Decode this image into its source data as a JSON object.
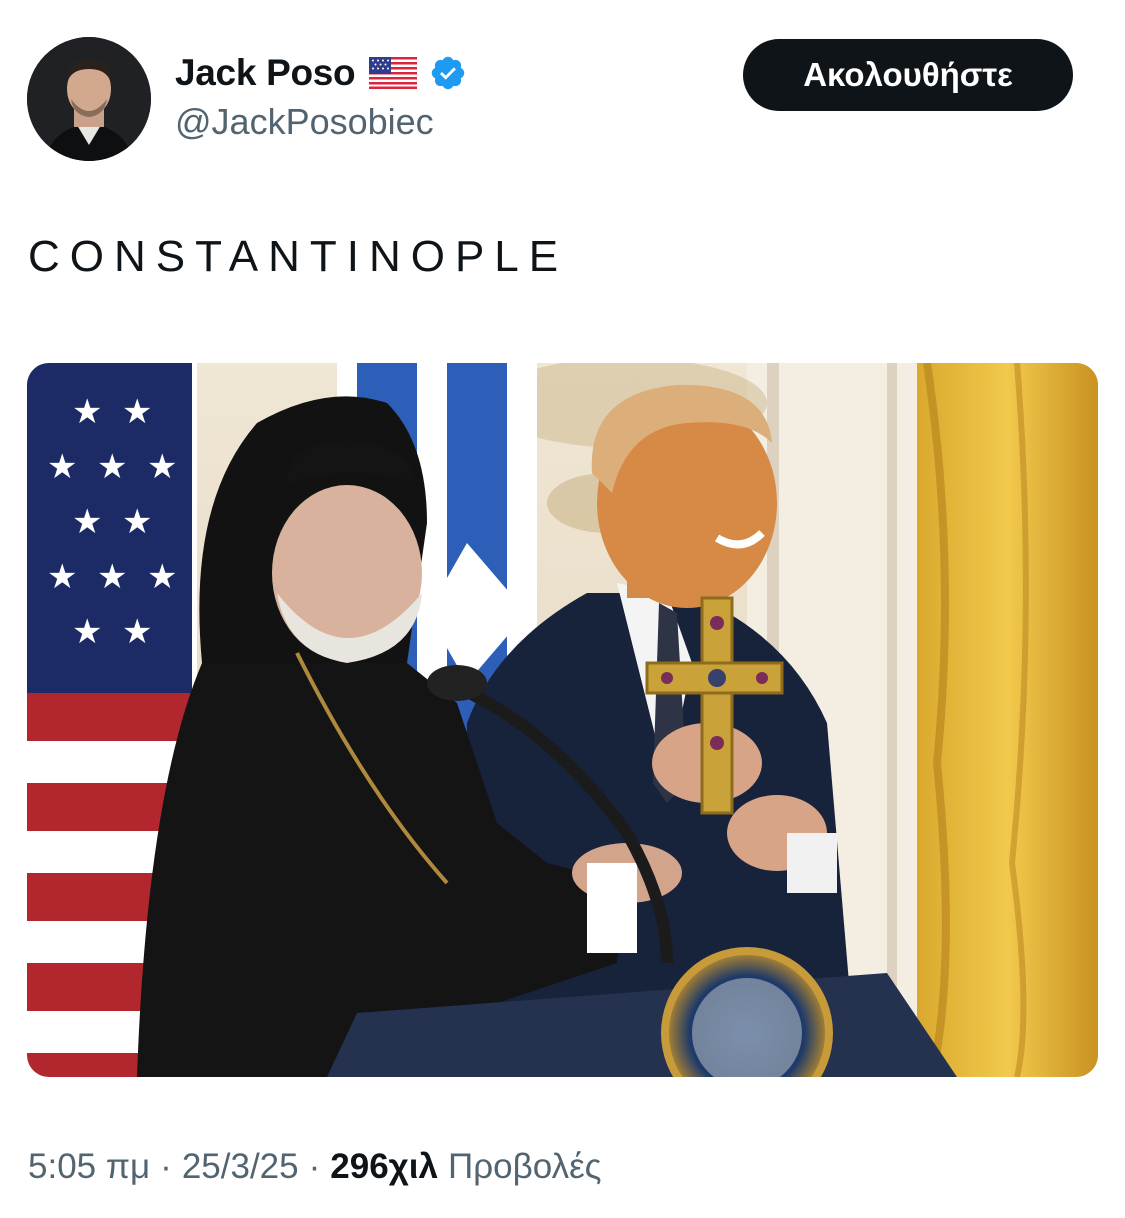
{
  "author": {
    "display_name": "Jack Poso",
    "handle": "@JackPosobiec",
    "flag_icon": "us-flag-icon",
    "verified_icon": "verified-badge-icon",
    "verified_color": "#1d9bf0"
  },
  "follow_button": {
    "label": "Ακολουθήστε"
  },
  "tweet": {
    "text": "CONSTANTINOPLE"
  },
  "meta": {
    "time": "5:05 πμ",
    "date": "25/3/25",
    "views_count": "296χιλ",
    "views_label": "Προβολές",
    "separator": "·"
  },
  "colors": {
    "text_primary": "#0f1419",
    "text_secondary": "#536471",
    "button_bg": "#0f1419"
  }
}
